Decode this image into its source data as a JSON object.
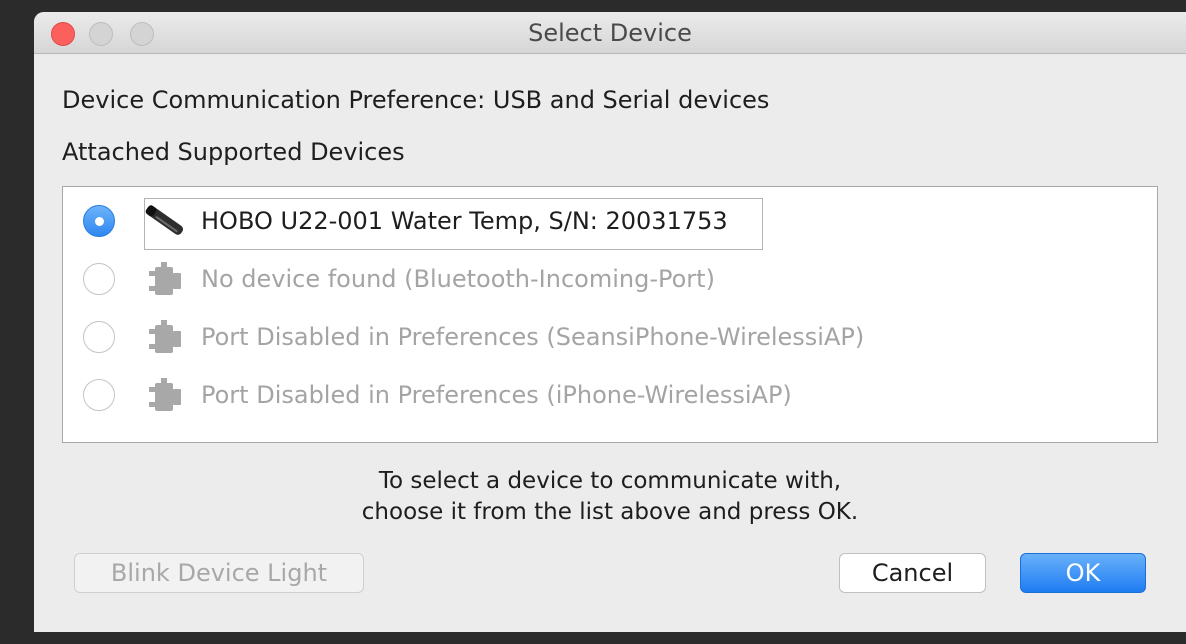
{
  "window": {
    "title": "Select Device"
  },
  "preference": {
    "label": "Device Communication Preference:",
    "value": "USB and Serial devices"
  },
  "devices_section": {
    "label": "Attached Supported Devices"
  },
  "devices": [
    {
      "label": "HOBO U22-001 Water Temp, S/N: 20031753",
      "icon": "logger-icon",
      "selected": true,
      "enabled": true
    },
    {
      "label": "No device found (Bluetooth-Incoming-Port)",
      "icon": "serial-port-icon",
      "selected": false,
      "enabled": false
    },
    {
      "label": "Port Disabled in Preferences (SeansiPhone-WirelessiAP)",
      "icon": "serial-port-icon",
      "selected": false,
      "enabled": false
    },
    {
      "label": "Port Disabled in Preferences (iPhone-WirelessiAP)",
      "icon": "serial-port-icon",
      "selected": false,
      "enabled": false
    }
  ],
  "instructions": {
    "line1": "To select a device to communicate with,",
    "line2": "choose it from the list above and press OK."
  },
  "buttons": {
    "blink": "Blink Device Light",
    "cancel": "Cancel",
    "ok": "OK"
  },
  "colors": {
    "accent": "#2f87f0",
    "close": "#fc605c",
    "disabled_text": "#a4a4a4"
  }
}
